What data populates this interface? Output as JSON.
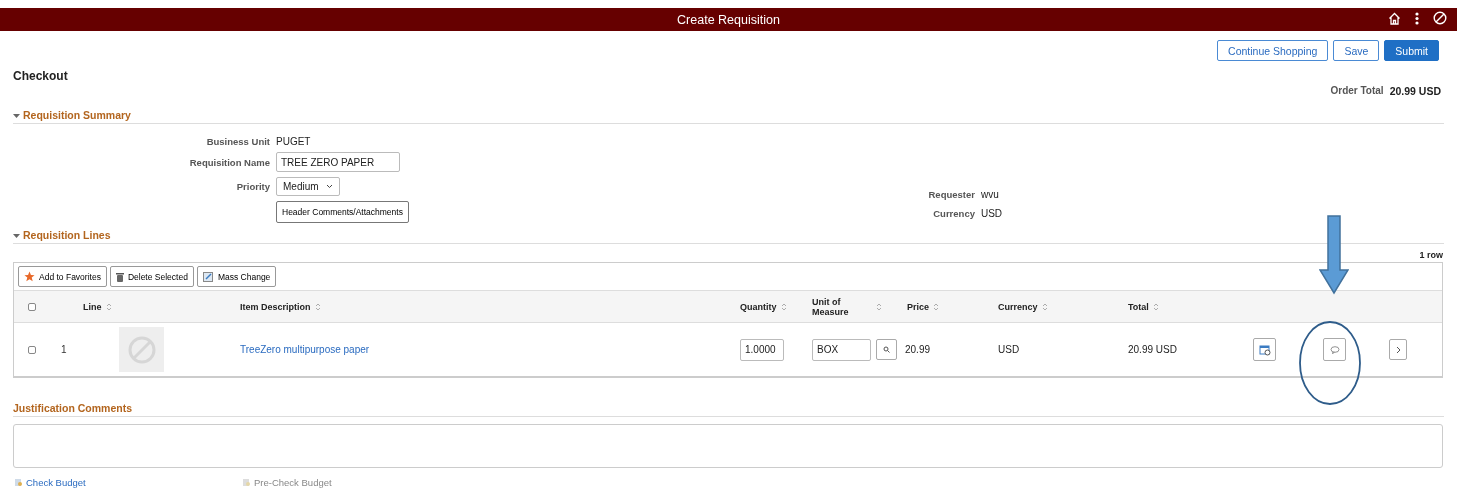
{
  "header": {
    "title": "Create Requisition"
  },
  "actions": [
    {
      "label": "Continue Shopping",
      "primary": false
    },
    {
      "label": "Save",
      "primary": false
    },
    {
      "label": "Submit",
      "primary": true
    }
  ],
  "page_title": "Checkout",
  "order_total": {
    "label": "Order Total",
    "value": "20.99 USD"
  },
  "summary": {
    "title": "Requisition Summary",
    "expanded": true,
    "business_unit": {
      "label": "Business Unit",
      "value": "PUGET"
    },
    "requisition_name": {
      "label": "Requisition Name",
      "value": "TREE ZERO PAPER"
    },
    "priority": {
      "label": "Priority",
      "value": "Medium"
    },
    "comments_button": "Header Comments/Attachments",
    "requester": {
      "label": "Requester",
      "value": "wvu"
    },
    "currency": {
      "label": "Currency",
      "value": "USD"
    }
  },
  "lines": {
    "title": "Requisition Lines",
    "expanded": true,
    "row_count": "1 row",
    "toolbar": [
      {
        "label": "Add to Favorites",
        "kind": "star"
      },
      {
        "label": "Delete Selected",
        "kind": "trash"
      },
      {
        "label": "Mass Change",
        "kind": "edit"
      }
    ],
    "columns": [
      {
        "label": "Line"
      },
      {
        "label": "Item Description"
      },
      {
        "label": "Quantity"
      },
      {
        "label": "Unit of Measure"
      },
      {
        "label": "Price"
      },
      {
        "label": "Currency"
      },
      {
        "label": "Total"
      }
    ],
    "select_all_checked": false,
    "rows": [
      {
        "checked": false,
        "line": "1",
        "description": "TreeZero multipurpose paper",
        "quantity": "1.0000",
        "unit": "BOX",
        "price": "20.99",
        "currency": "USD",
        "total": "20.99 USD"
      }
    ]
  },
  "justification": {
    "title": "Justification Comments"
  },
  "footer_links": [
    {
      "label": "Check Budget",
      "disabled": false
    },
    {
      "label": "Pre-Check Budget",
      "disabled": true
    }
  ]
}
